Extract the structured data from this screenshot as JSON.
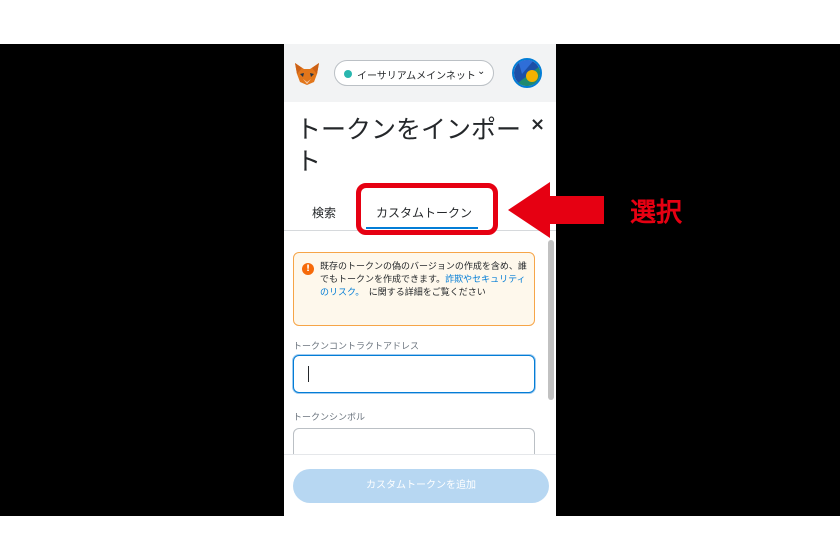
{
  "network": {
    "name": "イーサリアムメインネット"
  },
  "modal": {
    "title": "トークンをインポート",
    "close_symbol": "×"
  },
  "tabs": [
    {
      "label": "検索"
    },
    {
      "label": "カスタムトークン",
      "selected": true
    }
  ],
  "warning": {
    "text_before_link": "既存のトークンの偽のバージョンの作成を含め、誰でもトークンを作成できます。",
    "link": "詐欺やセキュリティのリスク。",
    "text_after_link": "　に関する詳細をご覧ください"
  },
  "fields": [
    {
      "label": "トークンコントラクトアドレス",
      "value": ""
    },
    {
      "label": "トークンシンボル",
      "value": ""
    }
  ],
  "add_button": {
    "label": "カスタムトークンを追加"
  },
  "annotation": {
    "label": "選択",
    "color": "#e60012"
  },
  "colors": {
    "accent": "#037dd6",
    "warning_border": "#f6a548",
    "network_dot": "#29b6af"
  }
}
